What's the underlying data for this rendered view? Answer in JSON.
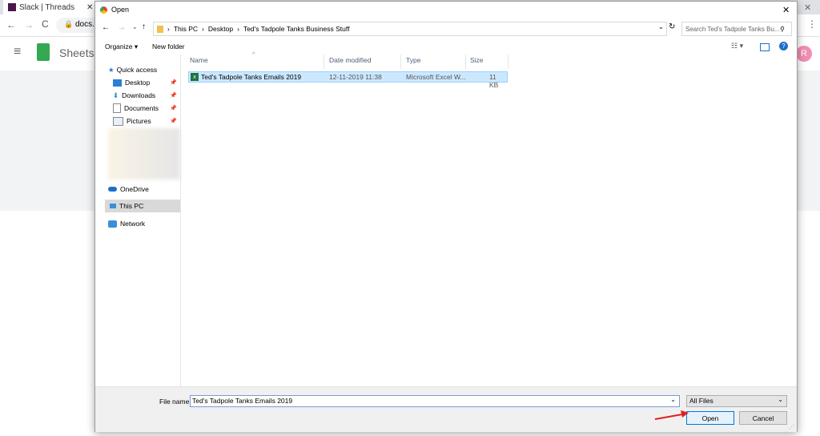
{
  "browser": {
    "tabs": [
      {
        "label": "Slack | Threads"
      },
      {
        "label": ""
      }
    ],
    "address": "docs.g",
    "app_name": "Sheets",
    "avatar_letter": "R"
  },
  "dialog": {
    "title": "Open",
    "breadcrumb": [
      "This PC",
      "Desktop",
      "Ted's Tadpole Tanks Business Stuff"
    ],
    "search_placeholder": "Search Ted's Tadpole Tanks Bu...",
    "toolbar": {
      "organize": "Organize ▾",
      "new_folder": "New folder"
    },
    "nav": {
      "quick_access": "Quick access",
      "desktop": "Desktop",
      "downloads": "Downloads",
      "documents": "Documents",
      "pictures": "Pictures",
      "onedrive": "OneDrive",
      "this_pc": "This PC",
      "network": "Network"
    },
    "columns": {
      "name": "Name",
      "date": "Date modified",
      "type": "Type",
      "size": "Size"
    },
    "files": [
      {
        "name": "Ted's Tadpole Tanks Emails 2019",
        "date": "12-11-2019 11:38",
        "type": "Microsoft Excel W...",
        "size": "11 KB"
      }
    ],
    "file_name_label": "File name:",
    "file_name_value": "Ted's Tadpole Tanks Emails 2019",
    "filter": "All Files",
    "open_label": "Open",
    "cancel_label": "Cancel"
  }
}
